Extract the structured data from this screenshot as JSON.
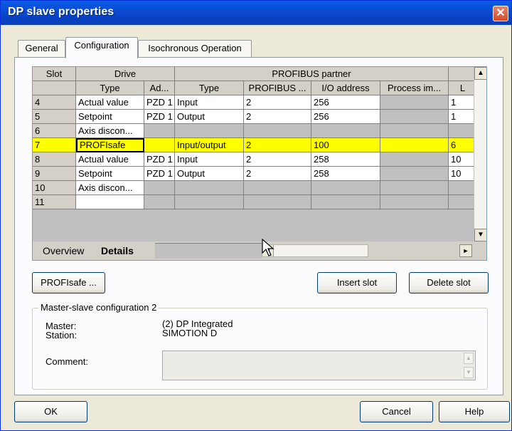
{
  "window": {
    "title": "DP slave properties",
    "close_glyph": "✕"
  },
  "tabs": [
    {
      "label": "General",
      "active": false
    },
    {
      "label": "Configuration",
      "active": true
    },
    {
      "label": "Isochronous Operation",
      "active": false
    }
  ],
  "grid": {
    "header_row1": {
      "slot": "Slot",
      "drive": "Drive",
      "partner": "PROFIBUS partner"
    },
    "header_row2": {
      "type": "Type",
      "address": "Ad...",
      "partner_type": "Type",
      "profibus": "PROFIBUS ...",
      "io_address": "I/O address",
      "process_image": "Process im...",
      "length": "L"
    },
    "rows": [
      {
        "slot": "4",
        "type": "Actual value",
        "addr": "PZD 1",
        "ptype": "Input",
        "profibus": "2",
        "io": "256",
        "proc": "",
        "len": "1",
        "selected": false
      },
      {
        "slot": "5",
        "type": "Setpoint",
        "addr": "PZD 1",
        "ptype": "Output",
        "profibus": "2",
        "io": "256",
        "proc": "",
        "len": "1",
        "selected": false
      },
      {
        "slot": "6",
        "type": "Axis discon...",
        "addr": "",
        "ptype": "",
        "profibus": "",
        "io": "",
        "proc": "",
        "len": "",
        "selected": false
      },
      {
        "slot": "7",
        "type": "PROFIsafe",
        "addr": "",
        "ptype": "Input/output",
        "profibus": "2",
        "io": "100",
        "proc": "",
        "len": "6",
        "selected": true
      },
      {
        "slot": "8",
        "type": "Actual value",
        "addr": "PZD 1",
        "ptype": "Input",
        "profibus": "2",
        "io": "258",
        "proc": "",
        "len": "10",
        "selected": false
      },
      {
        "slot": "9",
        "type": "Setpoint",
        "addr": "PZD 1",
        "ptype": "Output",
        "profibus": "2",
        "io": "258",
        "proc": "",
        "len": "10",
        "selected": false
      },
      {
        "slot": "10",
        "type": "Axis discon...",
        "addr": "",
        "ptype": "",
        "profibus": "",
        "io": "",
        "proc": "",
        "len": "",
        "selected": false
      },
      {
        "slot": "11",
        "type": "",
        "addr": "",
        "ptype": "",
        "profibus": "",
        "io": "",
        "proc": "",
        "len": "",
        "selected": false
      }
    ],
    "sheet_tabs": {
      "overview": "Overview",
      "details": "Details"
    },
    "scroll_up": "▲",
    "scroll_down": "▼",
    "scroll_left": "◄",
    "scroll_right": "►"
  },
  "buttons": {
    "profisafe": "PROFIsafe ...",
    "insert_slot": "Insert slot",
    "delete_slot": "Delete slot",
    "ok": "OK",
    "cancel": "Cancel",
    "help": "Help"
  },
  "master_slave": {
    "title": "Master-slave configuration 2",
    "master_label": "Master:",
    "master_value": "(2) DP Integrated",
    "station_label": "Station:",
    "station_value": "SIMOTION D",
    "comment_label": "Comment:"
  },
  "colors": {
    "selection": "#ffff00",
    "title_bar": "#0b4fd8",
    "grid_gray": "#c0c0c0"
  }
}
